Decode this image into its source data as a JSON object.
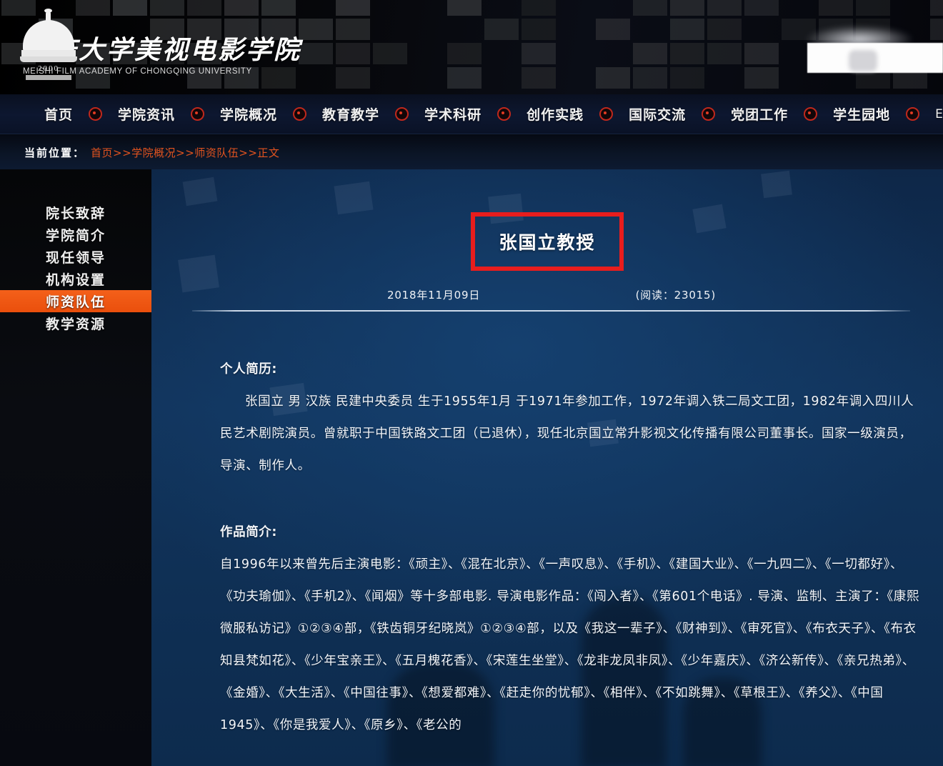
{
  "site": {
    "logo_icon": "university-dome-logo-icon",
    "cn_name": "重庆大学美视电影学院",
    "en_name": "MEISHI FILM ACADEMY  OF CHONGQING UNIVERSITY",
    "logo_year": "2000",
    "accent_orange": "#ea4f0c",
    "accent_red": "#e81d1d",
    "nav_dot_red": "#c0281c",
    "content_blue": "#11345c"
  },
  "nav": {
    "items": [
      {
        "label": "首页"
      },
      {
        "label": "学院资讯"
      },
      {
        "label": "学院概况"
      },
      {
        "label": "教育教学"
      },
      {
        "label": "学术科研"
      },
      {
        "label": "创作实践"
      },
      {
        "label": "国际交流"
      },
      {
        "label": "党团工作"
      },
      {
        "label": "学生园地"
      },
      {
        "label": "English"
      }
    ]
  },
  "breadcrumb": {
    "label": "当前位置：",
    "path": "首页>>学院概况>>师资队伍>>正文"
  },
  "sidebar": {
    "items": [
      {
        "label": "院长致辞",
        "active": false
      },
      {
        "label": "学院简介",
        "active": false
      },
      {
        "label": "现任领导",
        "active": false
      },
      {
        "label": "机构设置",
        "active": false
      },
      {
        "label": "师资队伍",
        "active": true
      },
      {
        "label": "教学资源",
        "active": false
      }
    ]
  },
  "article": {
    "title": "张国立教授",
    "date": "2018年11月09日",
    "views": "(阅读：23015)",
    "section_profile_heading": "个人简历:",
    "profile_paragraph": "张国立 男 汉族 民建中央委员 生于1955年1月 于1971年参加工作，1972年调入铁二局文工团，1982年调入四川人民艺术剧院演员。曾就职于中国铁路文工团（已退休），现任北京国立常升影视文化传播有限公司董事长。国家一级演员，导演、制作人。",
    "section_works_heading": "作品简介:",
    "works_paragraph": "自1996年以来曾先后主演电影：《顽主》、《混在北京》、《一声叹息》、《手机》、《建国大业》、《一九四二》、《一切都好》、《功夫瑜伽》、《手机2》、《闻烟》等十多部电影. 导演电影作品：《闯入者》、《第601个电话》. 导演、监制、主演了：《康熙微服私访记》①②③④部，《铁齿铜牙纪晓岚》①②③④部，以及《我这一辈子》、《财神到》、《审死官》、《布衣天子》、《布衣知县梵如花》、《少年宝亲王》、《五月槐花香》、《宋莲生坐堂》、《龙非龙凤非凤》、《少年嘉庆》、《济公新传》、《亲兄热弟》、《金婚》、《大生活》、《中国往事》、《想爱都难》、《赶走你的忧郁》、《相伴》、《不如跳舞》、《草根王》、《养父》、《中国1945》、《你是我爱人》、《原乡》、《老公的"
  }
}
